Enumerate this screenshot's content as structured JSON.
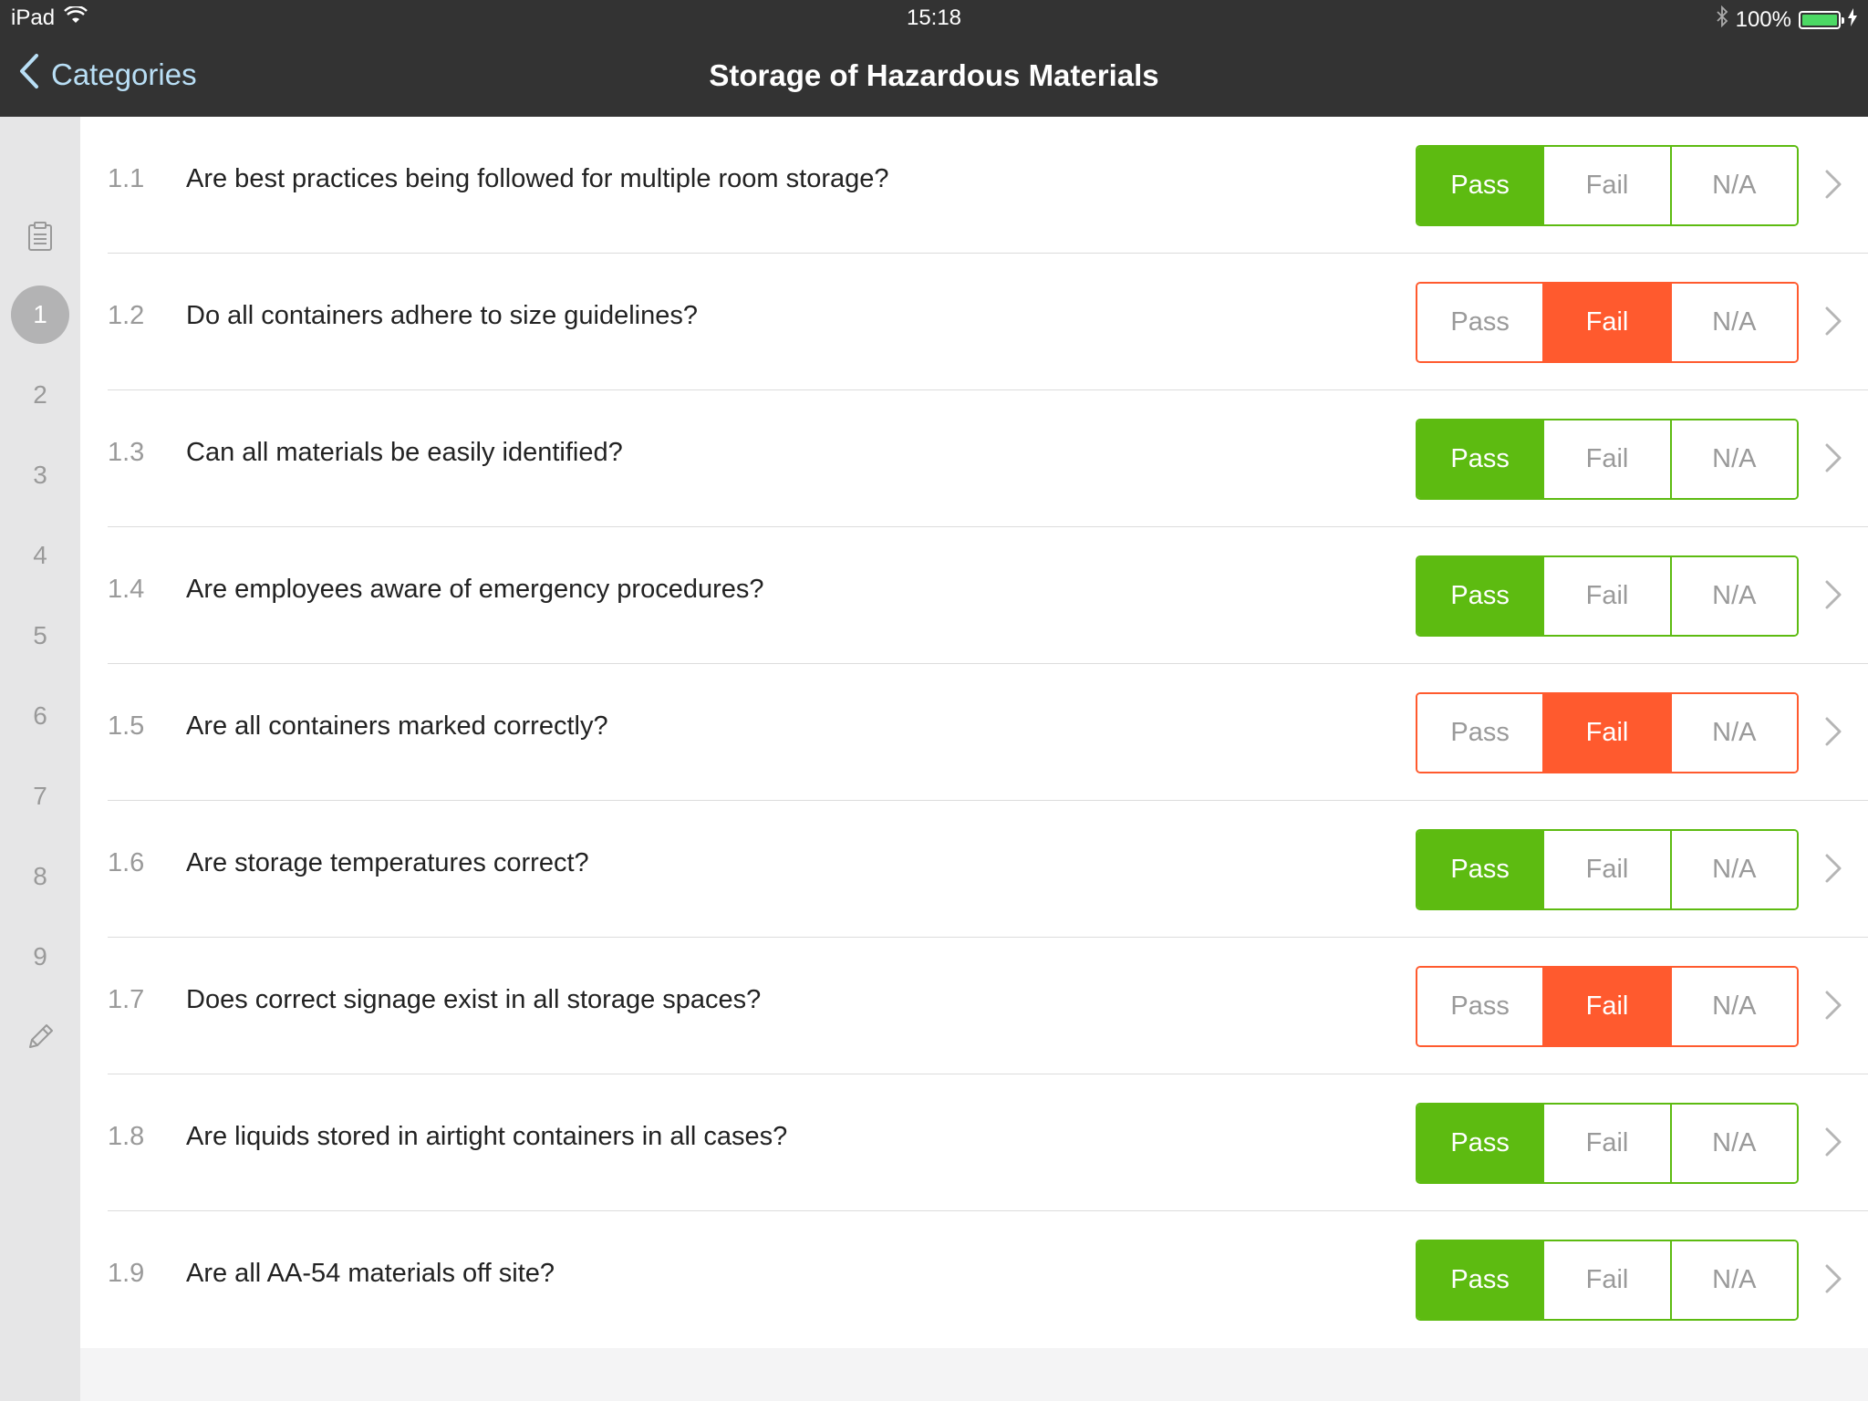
{
  "status_bar": {
    "device": "iPad",
    "time": "15:18",
    "battery": "100%",
    "battery_level": 1.0
  },
  "nav": {
    "back_label": "Categories",
    "title": "Storage of Hazardous Materials"
  },
  "sidebar": {
    "top_icon": "clipboard-icon",
    "bottom_icon": "pencil-icon",
    "sections": [
      "1",
      "2",
      "3",
      "4",
      "5",
      "6",
      "7",
      "8",
      "9"
    ],
    "active_section": "1"
  },
  "options": [
    "Pass",
    "Fail",
    "N/A"
  ],
  "colors": {
    "pass": "#5dbb11",
    "fail": "#ff5a2e",
    "header": "#333333",
    "back_link": "#b9dff6"
  },
  "items": [
    {
      "num": "1.1",
      "question": "Are best practices being followed for multiple room storage?",
      "result": "Pass"
    },
    {
      "num": "1.2",
      "question": "Do all containers adhere to size guidelines?",
      "result": "Fail"
    },
    {
      "num": "1.3",
      "question": "Can all materials be easily identified?",
      "result": "Pass"
    },
    {
      "num": "1.4",
      "question": "Are employees aware of emergency procedures?",
      "result": "Pass"
    },
    {
      "num": "1.5",
      "question": "Are all containers marked correctly?",
      "result": "Fail"
    },
    {
      "num": "1.6",
      "question": "Are storage temperatures correct?",
      "result": "Pass"
    },
    {
      "num": "1.7",
      "question": "Does correct signage exist in all storage spaces?",
      "result": "Fail"
    },
    {
      "num": "1.8",
      "question": "Are liquids stored in airtight containers in all cases?",
      "result": "Pass"
    },
    {
      "num": "1.9",
      "question": "Are all AA-54 materials off site?",
      "result": "Pass"
    }
  ]
}
